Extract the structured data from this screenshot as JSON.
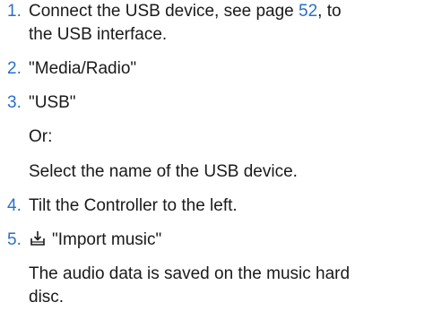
{
  "steps": [
    {
      "number": "1.",
      "text_part1": "Connect the USB device, see page ",
      "page_link": "52",
      "text_part2": ", to",
      "text_line2": "the USB interface."
    },
    {
      "number": "2.",
      "text": "\"Media/Radio\""
    },
    {
      "number": "3.",
      "text": "\"USB\""
    },
    {
      "or_label": "Or:"
    },
    {
      "text": "Select the name of the USB device."
    },
    {
      "number": "4.",
      "text": "Tilt the Controller to the left."
    },
    {
      "number": "5.",
      "icon": "import-music-icon",
      "text": "\"Import music\""
    },
    {
      "note_line1": "The audio data is saved on the music hard",
      "note_line2": "disc."
    }
  ],
  "colors": {
    "accent": "#2a6fc9",
    "text": "#1a1a1a"
  }
}
